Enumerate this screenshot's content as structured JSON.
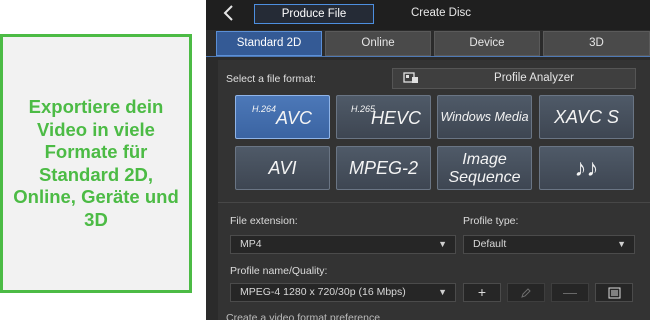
{
  "callout": {
    "text": "Exportiere dein Video in viele Formate für Standard 2D, Online, Geräte und 3D"
  },
  "topbar": {
    "back_icon": "chevron-left-icon",
    "tabs": [
      "Produce File",
      "Create Disc"
    ]
  },
  "mode_tabs": [
    "Standard 2D",
    "Online",
    "Device",
    "3D"
  ],
  "format_section": {
    "label": "Select a file format:",
    "analyzer_label": "Profile Analyzer",
    "analyzer_icon": "profile-analyzer-icon"
  },
  "formats": [
    {
      "sup": "H.264",
      "main": "AVC",
      "selected": true
    },
    {
      "sup": "H.265",
      "main": "HEVC"
    },
    {
      "main": "Windows Media"
    },
    {
      "main": "XAVC S"
    },
    {
      "main": "AVI"
    },
    {
      "main": "MPEG-2"
    },
    {
      "line1": "Image",
      "line2": "Sequence"
    },
    {
      "main": "♪♪",
      "icon": "audio-icon"
    }
  ],
  "settings": {
    "file_extension_label": "File extension:",
    "file_extension_value": "MP4",
    "profile_type_label": "Profile type:",
    "profile_type_value": "Default",
    "profile_name_label": "Profile name/Quality:",
    "profile_name_value": "MPEG-4 1280 x 720/30p (16 Mbps)",
    "buttons": {
      "add": "+",
      "edit_icon": "pencil-icon",
      "remove": "—",
      "details_icon": "list-icon"
    },
    "cut_off_text": "Create a video format preference"
  },
  "colors": {
    "accent": "#4cbb45",
    "selection": "#4c78b8",
    "tab_active": "#345a95"
  }
}
